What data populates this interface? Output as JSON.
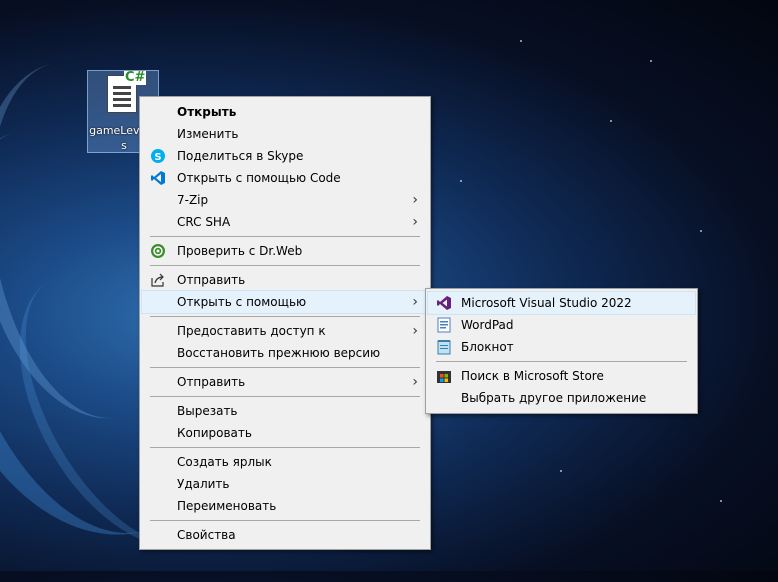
{
  "desktop": {
    "file_icon": {
      "badge": "C#",
      "label": "gameLevel.cs"
    }
  },
  "context_menu": {
    "items": [
      {
        "label": "Открыть",
        "icon": "none",
        "bold": true
      },
      {
        "label": "Изменить",
        "icon": "none"
      },
      {
        "label": "Поделиться в Skype",
        "icon": "skype-icon"
      },
      {
        "label": "Открыть с помощью Code",
        "icon": "vscode-icon"
      },
      {
        "label": "7-Zip",
        "icon": "none",
        "submenu": true
      },
      {
        "label": "CRC SHA",
        "icon": "none",
        "submenu": true
      },
      {
        "label": "Проверить с Dr.Web",
        "icon": "drweb-icon"
      },
      {
        "label": "Отправить",
        "icon": "share-icon"
      },
      {
        "label": "Открыть с помощью",
        "icon": "none",
        "submenu": true,
        "highlighted": true
      },
      {
        "label": "Предоставить доступ к",
        "icon": "none",
        "submenu": true
      },
      {
        "label": "Восстановить прежнюю версию",
        "icon": "none"
      },
      {
        "label": "Отправить",
        "icon": "none",
        "submenu": true
      },
      {
        "label": "Вырезать",
        "icon": "none"
      },
      {
        "label": "Копировать",
        "icon": "none"
      },
      {
        "label": "Создать ярлык",
        "icon": "none"
      },
      {
        "label": "Удалить",
        "icon": "none"
      },
      {
        "label": "Переименовать",
        "icon": "none"
      },
      {
        "label": "Свойства",
        "icon": "none"
      }
    ]
  },
  "open_with_submenu": {
    "items": [
      {
        "label": "Microsoft Visual Studio 2022",
        "icon": "visual-studio-icon",
        "highlighted": true
      },
      {
        "label": "WordPad",
        "icon": "wordpad-icon"
      },
      {
        "label": "Блокнот",
        "icon": "notepad-icon"
      },
      {
        "label": "Поиск в Microsoft Store",
        "icon": "microsoft-store-icon"
      },
      {
        "label": "Выбрать другое приложение",
        "icon": "none"
      }
    ]
  },
  "colors": {
    "menu_bg": "#f0f0f0",
    "highlight": "#e5f1fb",
    "vs_purple": "#68217a",
    "vscode_blue": "#0078d4",
    "skype_blue": "#00aff0"
  }
}
